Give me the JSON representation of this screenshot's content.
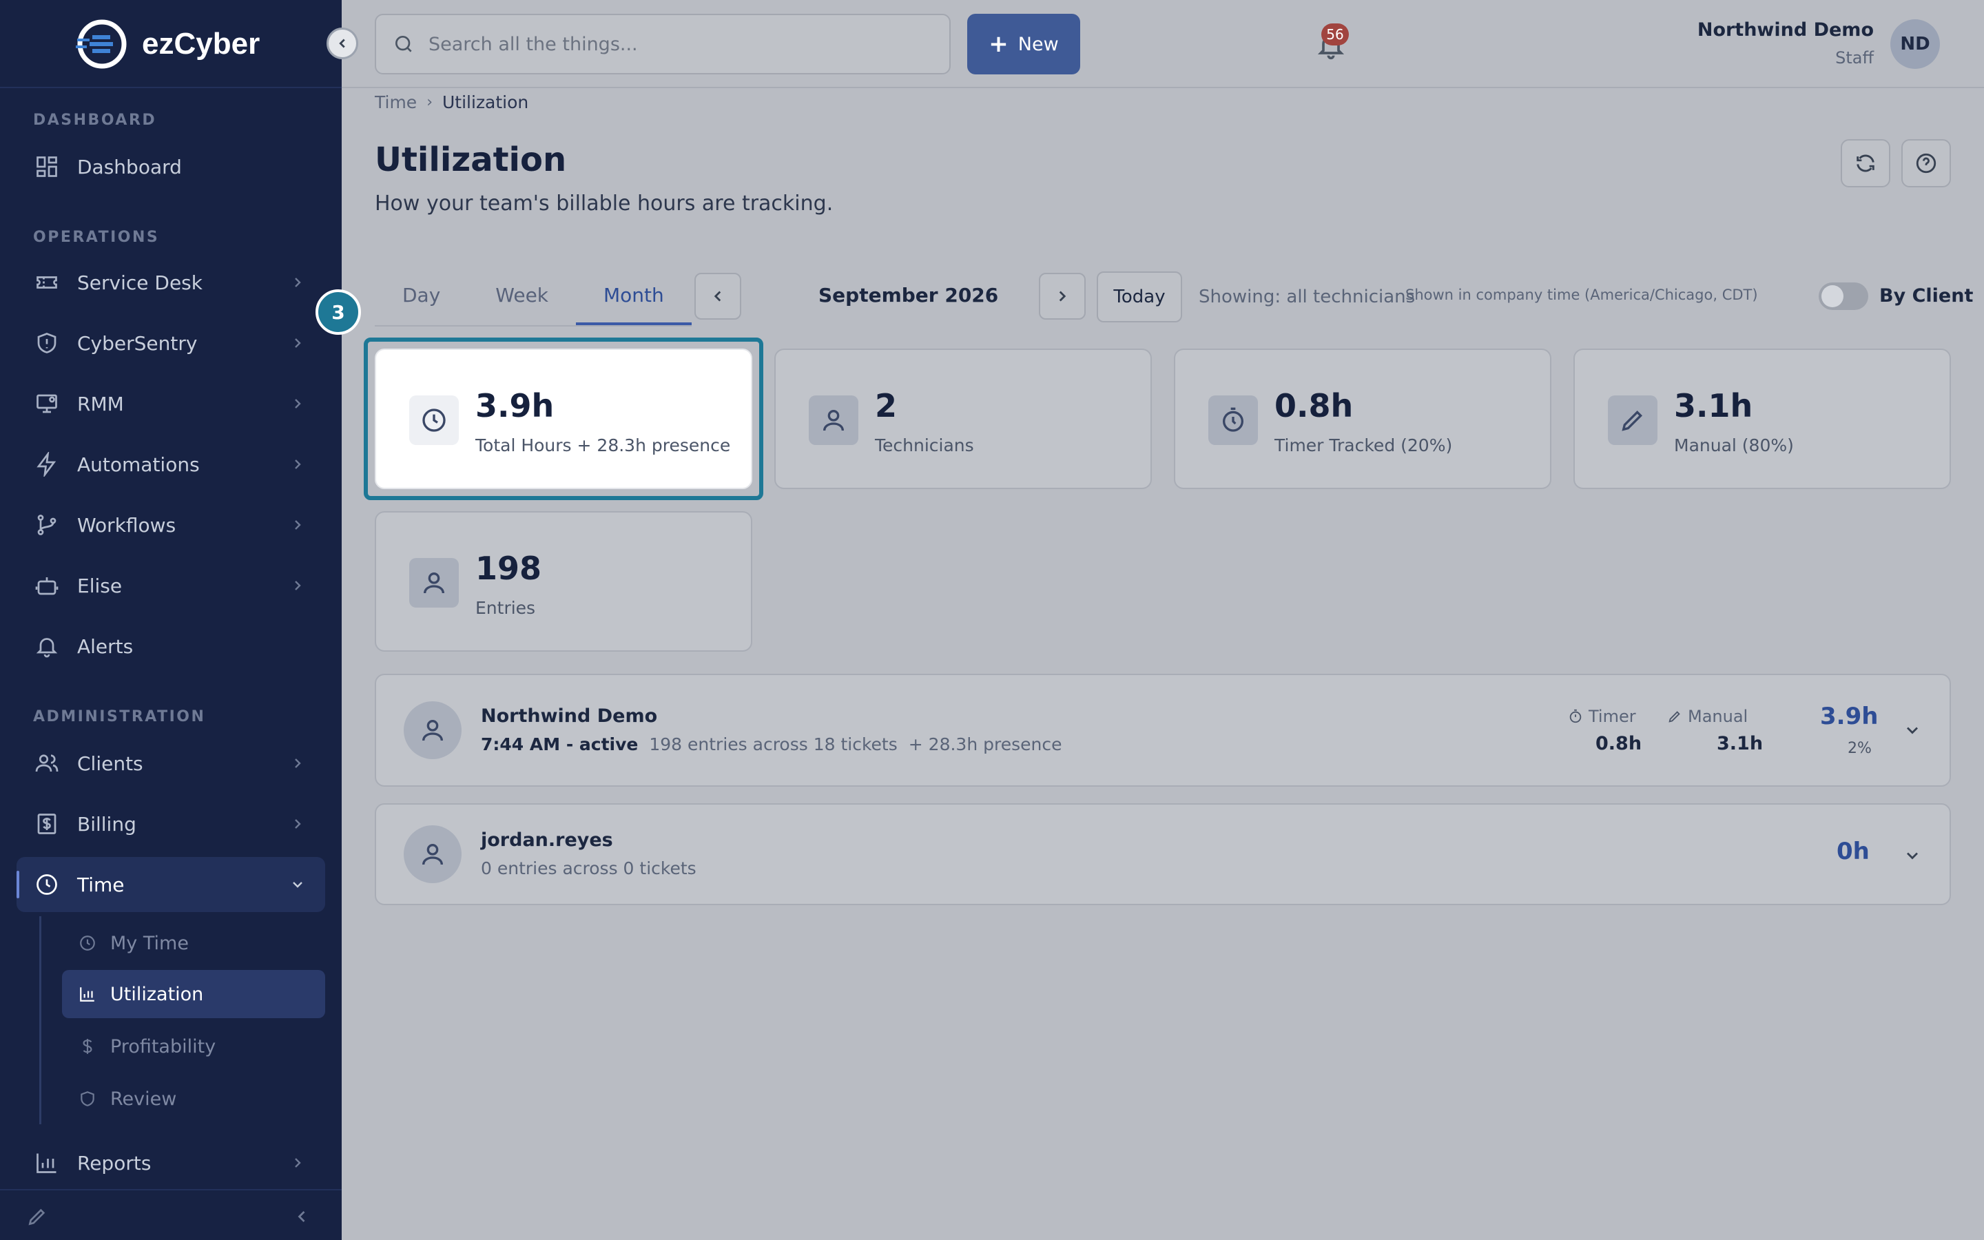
{
  "app": {
    "brand": "ezCyber"
  },
  "sidebar": {
    "sections": {
      "dashboard": "DASHBOARD",
      "operations": "OPERATIONS",
      "administration": "ADMINISTRATION"
    },
    "items": {
      "dashboard": "Dashboard",
      "service_desk": "Service Desk",
      "cybersentry": "CyberSentry",
      "rmm": "RMM",
      "automations": "Automations",
      "workflows": "Workflows",
      "elise": "Elise",
      "alerts": "Alerts",
      "clients": "Clients",
      "billing": "Billing",
      "time": "Time",
      "reports": "Reports"
    },
    "time_sub": {
      "my_time": "My Time",
      "utilization": "Utilization",
      "profitability": "Profitability",
      "review": "Review"
    }
  },
  "topbar": {
    "search_placeholder": "Search all the things...",
    "new_label": "New",
    "notifications_count": "56",
    "user_name": "Northwind Demo",
    "user_role": "Staff",
    "avatar_initials": "ND"
  },
  "breadcrumb": {
    "parent": "Time",
    "current": "Utilization"
  },
  "page": {
    "title": "Utilization",
    "subtitle": "How your team's billable hours are tracking."
  },
  "controls": {
    "tabs": [
      "Day",
      "Week",
      "Month"
    ],
    "active_tab": "Month",
    "period_label": "September 2026",
    "today_label": "Today",
    "showing_text": "Showing: all technicians",
    "timezone_note": "Shown in company time (America/Chicago, CDT)",
    "by_client_label": "By Client",
    "by_client_on": false
  },
  "stats": [
    {
      "value": "3.9h",
      "label": "Total Hours + 28.3h presence",
      "icon": "clock-icon"
    },
    {
      "value": "2",
      "label": "Technicians",
      "icon": "user-icon"
    },
    {
      "value": "0.8h",
      "label": "Timer Tracked (20%)",
      "icon": "stopwatch-icon"
    },
    {
      "value": "3.1h",
      "label": "Manual (80%)",
      "icon": "pencil-icon"
    },
    {
      "value": "198",
      "label": "Entries",
      "icon": "user-icon"
    }
  ],
  "tour": {
    "step": "3"
  },
  "technicians": [
    {
      "name": "Northwind Demo",
      "status": "7:44 AM - active",
      "entries": "198 entries across 18 tickets",
      "presence": "+ 28.3h presence",
      "timer_label": "Timer",
      "timer_value": "0.8h",
      "manual_label": "Manual",
      "manual_value": "3.1h",
      "total": "3.9h",
      "percent": "2%"
    },
    {
      "name": "jordan.reyes",
      "entries": "0 entries across 0 tickets",
      "total": "0h"
    }
  ],
  "colors": {
    "sidebar_bg": "#172243",
    "primary": "#3f5a96",
    "accent_ring": "#1e7896",
    "badge": "#a1443f"
  }
}
